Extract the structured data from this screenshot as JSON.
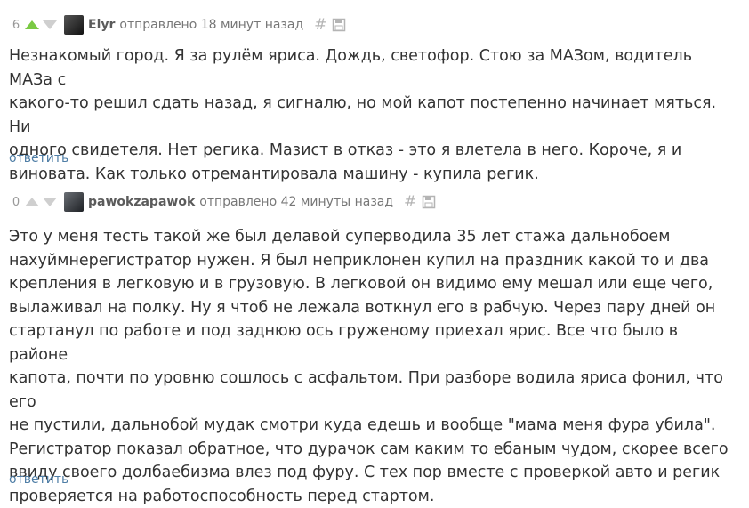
{
  "comments": [
    {
      "score": "6",
      "author": "Elyr",
      "posted": "отправлено 18 минут назад",
      "hash": "#",
      "text": "Незнакомый город. Я за рулём яриса. Дождь, светофор. Стою за МАЗом, водитель МАЗа с\nкакого-то решил сдать назад, я сигналю, но мой капот постепенно начинает мяться. Ни\nодного свидетеля. Нет регика. Мазист в отказ - это я влетела в него. Короче, я и\nвиновата. Как только отремантировала машину - купила регик.",
      "reply": "ответить",
      "up_icon": "triangle-up-icon",
      "down_icon": "triangle-down-icon",
      "up_color": "#7ac943"
    },
    {
      "score": "0",
      "author": "pawokzapawok",
      "posted": "отправлено 42 минуты назад",
      "hash": "#",
      "text": "Это у меня тесть такой же был делавой суперводила 35 лет стажа дальнобоем\nнахуймнерегистратор нужен. Я был неприклонен купил на праздник какой то и два\nкрепления в легковую и в грузовую. В легковой он видимо ему мешал или еще чего,\nвылаживал на полку. Ну я чтоб не лежала воткнул его в рабчую. Через пару дней он\nстартанул по работе и под заднюю ось груженому приехал ярис. Все что было в районе\nкапота, почти по уровню сошлось с асфальтом. При разборе водила яриса фонил, что его\nне пустили, дальнобой мудак смотри куда едешь и вообще \"мама меня фура убила\".\nРегистратор показал обратное, что дурачок сам каким то ебаным чудом, скорее всего\nввиду своего долбаебизма влез под фуру. С тех пор вместе с проверкой авто и регик\nпроверяется на работоспособность перед стартом.",
      "reply": "ответить",
      "up_icon": "triangle-up-icon",
      "down_icon": "triangle-down-icon",
      "up_color": "#cfcfcf"
    }
  ]
}
